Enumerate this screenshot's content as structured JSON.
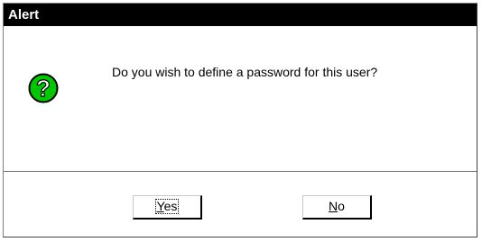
{
  "dialog": {
    "title": "Alert",
    "icon": "question-icon",
    "icon_glyph": "?",
    "message": "Do you wish to define a password for this user?"
  },
  "buttons": {
    "yes": {
      "mnemonic": "Y",
      "rest": "es"
    },
    "no": {
      "mnemonic": "N",
      "rest": "o"
    }
  },
  "colors": {
    "titlebar": "#000000",
    "icon_fill": "#00c800",
    "icon_glyph": "#ffffff"
  }
}
